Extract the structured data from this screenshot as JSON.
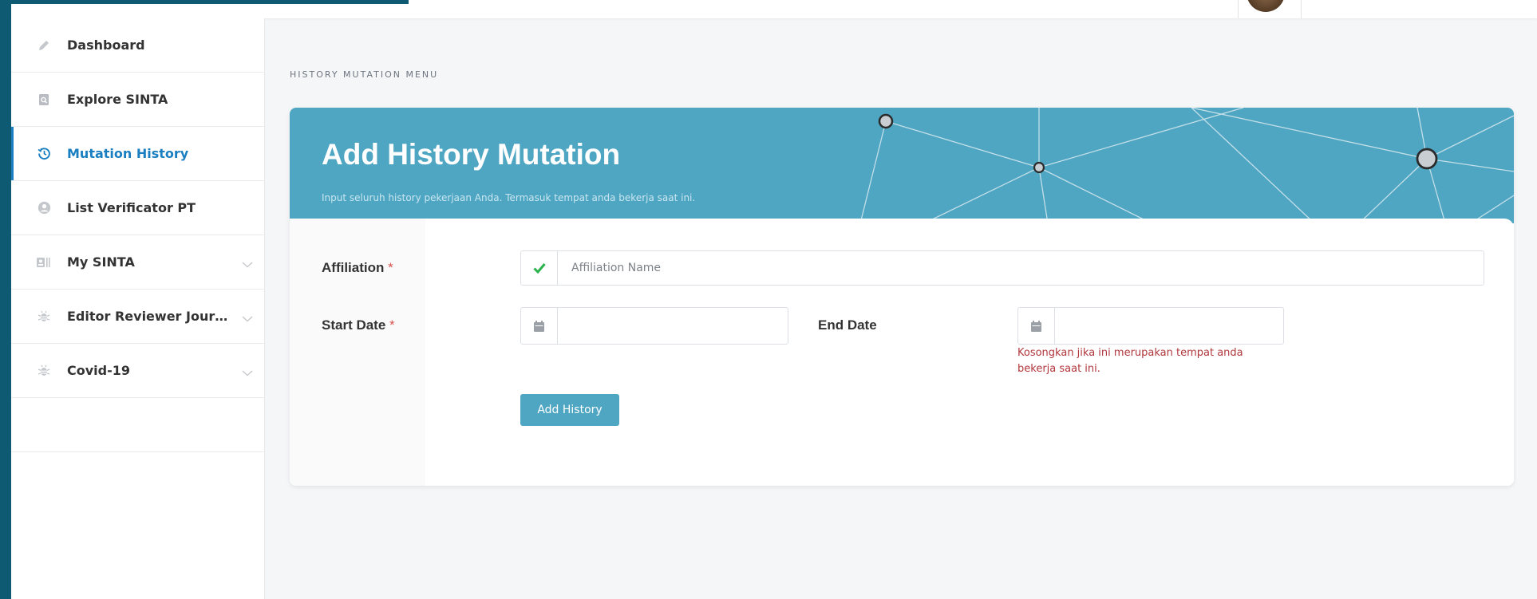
{
  "sidebar": {
    "items": [
      {
        "label": "Dashboard",
        "icon": "pencil-icon"
      },
      {
        "label": "Explore SINTA",
        "icon": "search-doc-icon"
      },
      {
        "label": "Mutation History",
        "icon": "history-icon"
      },
      {
        "label": "List Verificator PT",
        "icon": "user-circle-icon"
      },
      {
        "label": "My SINTA",
        "icon": "id-card-icon"
      },
      {
        "label": "Editor Reviewer Journal G...",
        "icon": "bug-icon"
      },
      {
        "label": "Covid-19",
        "icon": "bug-icon"
      }
    ],
    "active_item": "Mutation History"
  },
  "breadcrumb": "HISTORY MUTATION MENU",
  "card": {
    "title": "Add History Mutation",
    "subtitle": "Input seluruh history pekerjaan Anda. Termasuk tempat anda bekerja saat ini."
  },
  "form": {
    "affiliation_label": "Affiliation",
    "affiliation_placeholder": "Affiliation Name",
    "start_date_label": "Start Date",
    "end_date_label": "End Date",
    "required_mark": "*",
    "end_date_hint": "Kosongkan jika ini merupakan tempat anda bekerja saat ini.",
    "submit_label": "Add History"
  },
  "colors": {
    "accent": "#4fa6c3",
    "active_nav": "#1a7fc1",
    "edge": "#0e5a73",
    "hint": "#b1373d",
    "check": "#2bb24c"
  }
}
